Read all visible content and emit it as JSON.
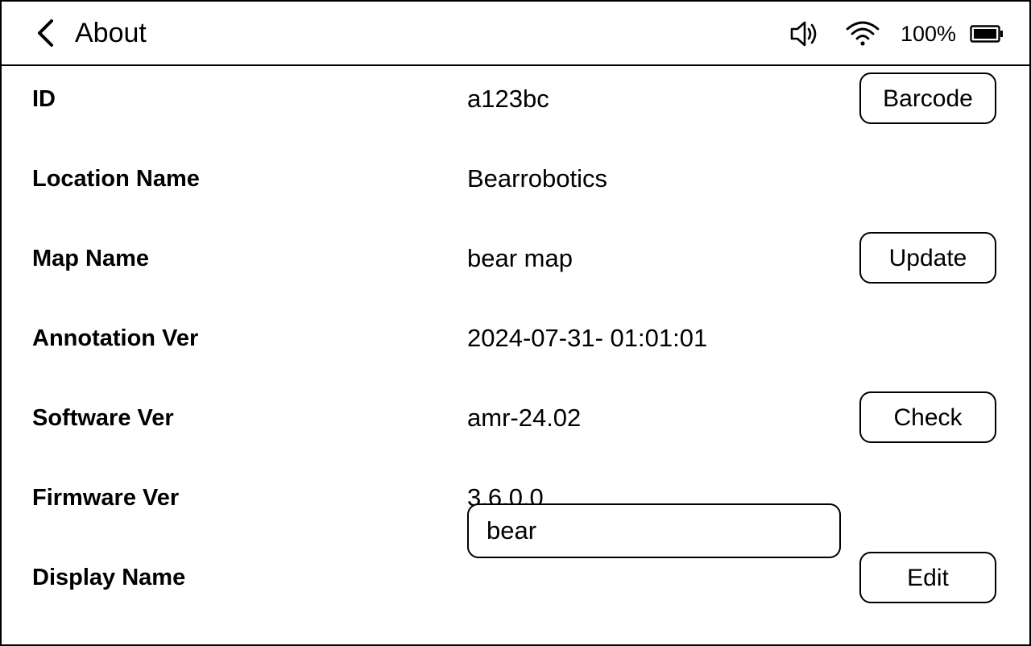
{
  "header": {
    "title": "About",
    "back_icon": "chevron-left-icon",
    "status": {
      "sound_icon": "speaker-icon",
      "wifi_icon": "wifi-icon",
      "battery_percent": "100%",
      "battery_icon": "battery-icon",
      "battery_level": 1.0
    }
  },
  "rows": [
    {
      "label": "ID",
      "value": "a123bc",
      "button": "Barcode"
    },
    {
      "label": "Location Name",
      "value": "Bearrobotics"
    },
    {
      "label": "Map Name",
      "value": "bear map",
      "button": "Update"
    },
    {
      "label": "Annotation Ver",
      "value": "2024-07-31- 01:01:01"
    },
    {
      "label": "Software Ver",
      "value": "amr-24.02",
      "button": "Check"
    },
    {
      "label": "Firmware Ver",
      "value": "3.6.0.0"
    },
    {
      "label": "Display Name",
      "input_value": "bear",
      "button": "Edit"
    }
  ],
  "colors": {
    "background": "#ffffff",
    "foreground": "#000000"
  }
}
